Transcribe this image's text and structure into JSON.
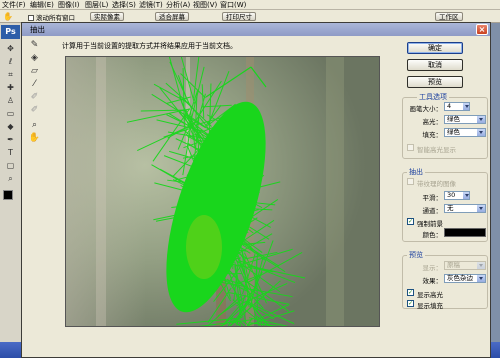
{
  "menubar": {
    "items": [
      "文件(F)",
      "编辑(E)",
      "图像(I)",
      "图层(L)",
      "选择(S)",
      "滤镜(T)",
      "分析(A)",
      "视图(V)",
      "窗口(W)"
    ],
    "workspace_label": "工作区"
  },
  "optionsbar": {
    "scroll_all_windows": "滚动所有窗口",
    "actual_pixels": "实际像素",
    "fit_screen": "适合屏幕",
    "print_size": "打印尺寸"
  },
  "toolbox": {
    "logo": "Ps"
  },
  "dialog": {
    "title": "抽出",
    "close_glyph": "×",
    "instructions": "计算用于当前设置的提取方式并将结果应用于当前文档。",
    "buttons": {
      "ok": "确定",
      "cancel": "取消",
      "preview": "预览"
    },
    "tool_options": {
      "title": "工具选项",
      "brush_size_label": "画笔大小：",
      "brush_size_value": "4",
      "highlighter_label": "高光：",
      "highlighter_value": "绿色",
      "fill_label": "填充：",
      "fill_value": "绿色",
      "smart_highlighting": "智能高光显示"
    },
    "extraction": {
      "title": "抽出",
      "textured_image": "带纹理的图像",
      "smooth_label": "平滑：",
      "smooth_value": "30",
      "channel_label": "通道：",
      "channel_value": "无",
      "force_foreground": "强制前景",
      "color_label": "颜色："
    },
    "preview": {
      "title": "预览",
      "show_label": "显示：",
      "show_value": "原稿",
      "effect_label": "效果：",
      "effect_value": "灰色杂边",
      "show_highlight": "显示高光",
      "show_fill": "显示填充"
    }
  },
  "colors": {
    "highlight_green": "#19d61c",
    "group_title": "#1a3f9e",
    "force_foreground_color": "#000000"
  }
}
